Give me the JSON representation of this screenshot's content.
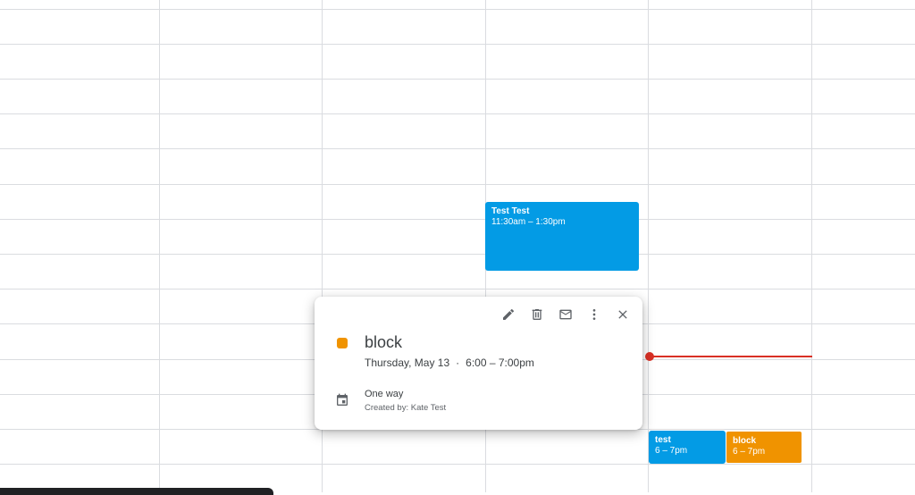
{
  "events": [
    {
      "title": "Test Test",
      "time": "11:30am – 1:30pm",
      "color": "#039be5"
    },
    {
      "title": "test",
      "time": "6 – 7pm",
      "color": "#039be5"
    },
    {
      "title": "block",
      "time": "6 – 7pm",
      "color": "#f09300"
    }
  ],
  "popup": {
    "title": "block",
    "date": "Thursday, May 13",
    "separator": "·",
    "time": "6:00 – 7:00pm",
    "color": "#f09300",
    "calendar": "One way",
    "created_by": "Created by: Kate Test",
    "toolbar": [
      "edit-icon",
      "delete-icon",
      "email-icon",
      "more-options-icon",
      "close-icon"
    ]
  },
  "now_indicator_color": "#d93025"
}
